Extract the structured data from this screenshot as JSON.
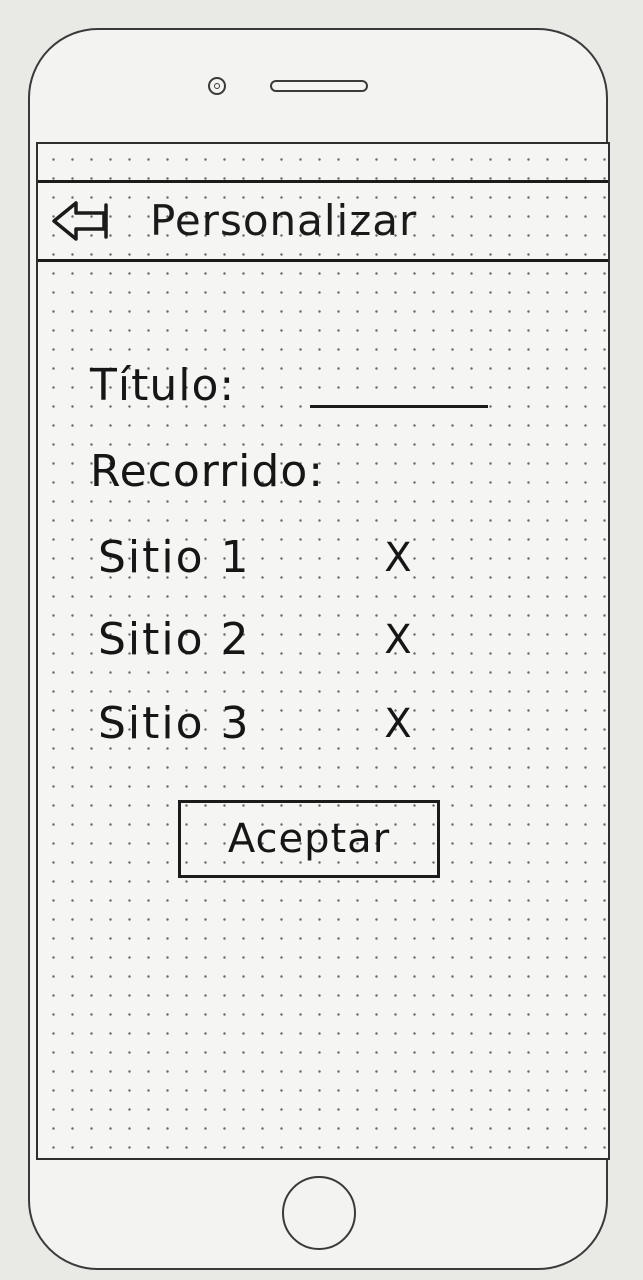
{
  "header": {
    "title": "Personalizar",
    "back_icon": "back-arrow-icon"
  },
  "form": {
    "title_label": "Título:",
    "title_value": "",
    "route_label": "Recorrido:",
    "sites": [
      {
        "name": "Sitio 1",
        "remove_label": "X"
      },
      {
        "name": "Sitio 2",
        "remove_label": "X"
      },
      {
        "name": "Sitio 3",
        "remove_label": "X"
      }
    ],
    "accept_label": "Aceptar"
  }
}
